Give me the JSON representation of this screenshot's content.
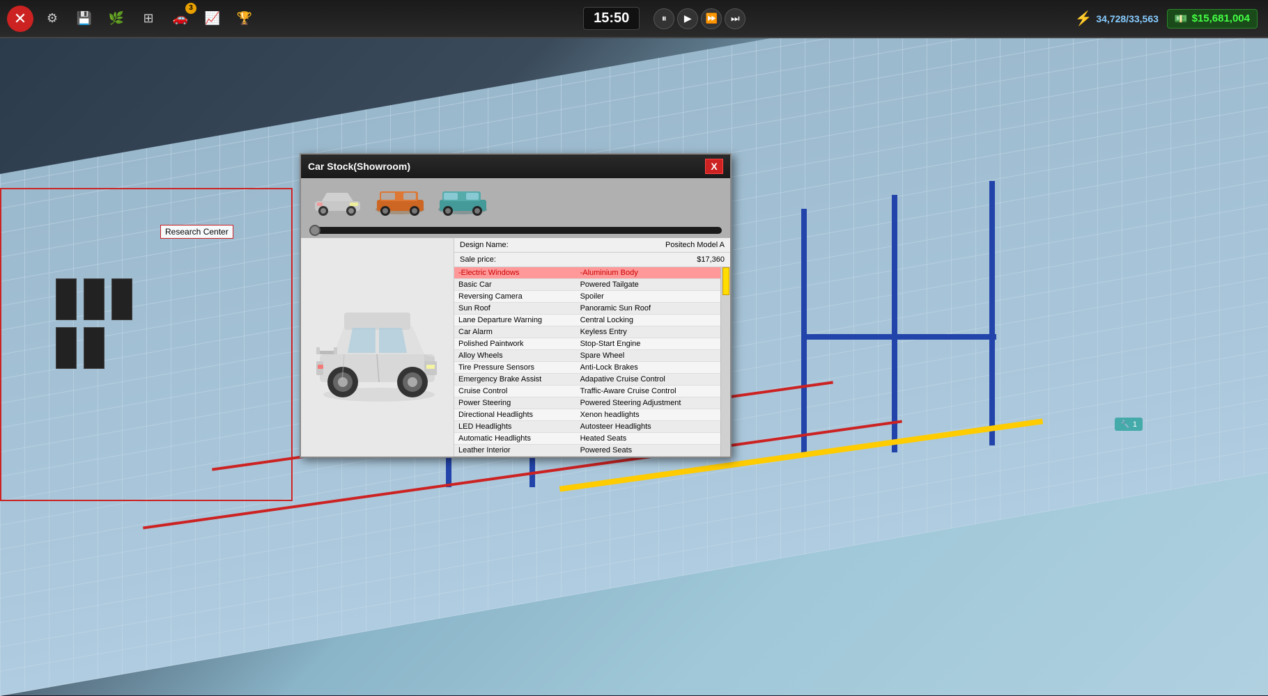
{
  "toolbar": {
    "icons": [
      {
        "name": "main-menu-icon",
        "symbol": "●",
        "isRed": true
      },
      {
        "name": "settings-icon",
        "symbol": "⚙"
      },
      {
        "name": "save-icon",
        "symbol": "💾"
      },
      {
        "name": "research-icon",
        "symbol": "🌿"
      },
      {
        "name": "layers-icon",
        "symbol": "⊞"
      },
      {
        "name": "car-icon",
        "symbol": "🚗"
      },
      {
        "name": "chart-icon",
        "symbol": "📈"
      },
      {
        "name": "trophy-icon",
        "symbol": "🏆"
      }
    ],
    "notification_badge": "3",
    "time": "15:50",
    "power": "34,728/33,563",
    "money": "$15,681,004"
  },
  "research_center": {
    "label": "Research Center"
  },
  "dialog": {
    "title": "Car Stock(Showroom)",
    "close_btn": "X",
    "design_name_label": "Design Name:",
    "design_name_value": "Positech Model A",
    "sale_price_label": "Sale price:",
    "sale_price_value": "$17,360",
    "features": [
      {
        "left": "-Electric Windows",
        "right": "-Aluminium Body",
        "highlighted": true
      },
      {
        "left": "Basic Car",
        "right": "Powered Tailgate",
        "highlighted": false
      },
      {
        "left": "Reversing Camera",
        "right": "Spoiler",
        "highlighted": false
      },
      {
        "left": "Sun Roof",
        "right": "Panoramic Sun Roof",
        "highlighted": false
      },
      {
        "left": "Lane Departure Warning",
        "right": "Central Locking",
        "highlighted": false
      },
      {
        "left": "Car Alarm",
        "right": "Keyless Entry",
        "highlighted": false
      },
      {
        "left": "Polished Paintwork",
        "right": "Stop-Start Engine",
        "highlighted": false
      },
      {
        "left": "Alloy Wheels",
        "right": "Spare Wheel",
        "highlighted": false
      },
      {
        "left": "Tire Pressure Sensors",
        "right": "Anti-Lock Brakes",
        "highlighted": false
      },
      {
        "left": "Emergency Brake Assist",
        "right": "Adapative Cruise Control",
        "highlighted": false
      },
      {
        "left": "Cruise Control",
        "right": "Traffic-Aware Cruise Control",
        "highlighted": false
      },
      {
        "left": "Power Steering",
        "right": "Powered Steering Adjustment",
        "highlighted": false
      },
      {
        "left": "Directional Headlights",
        "right": "Xenon headlights",
        "highlighted": false
      },
      {
        "left": "LED Headlights",
        "right": "Autosteer Headlights",
        "highlighted": false
      },
      {
        "left": "Automatic Headlights",
        "right": "Heated Seats",
        "highlighted": false
      },
      {
        "left": "Leather Interior",
        "right": "Powered Seats",
        "highlighted": false
      }
    ]
  },
  "tool_badge": {
    "icon": "🔧",
    "count": "1"
  }
}
